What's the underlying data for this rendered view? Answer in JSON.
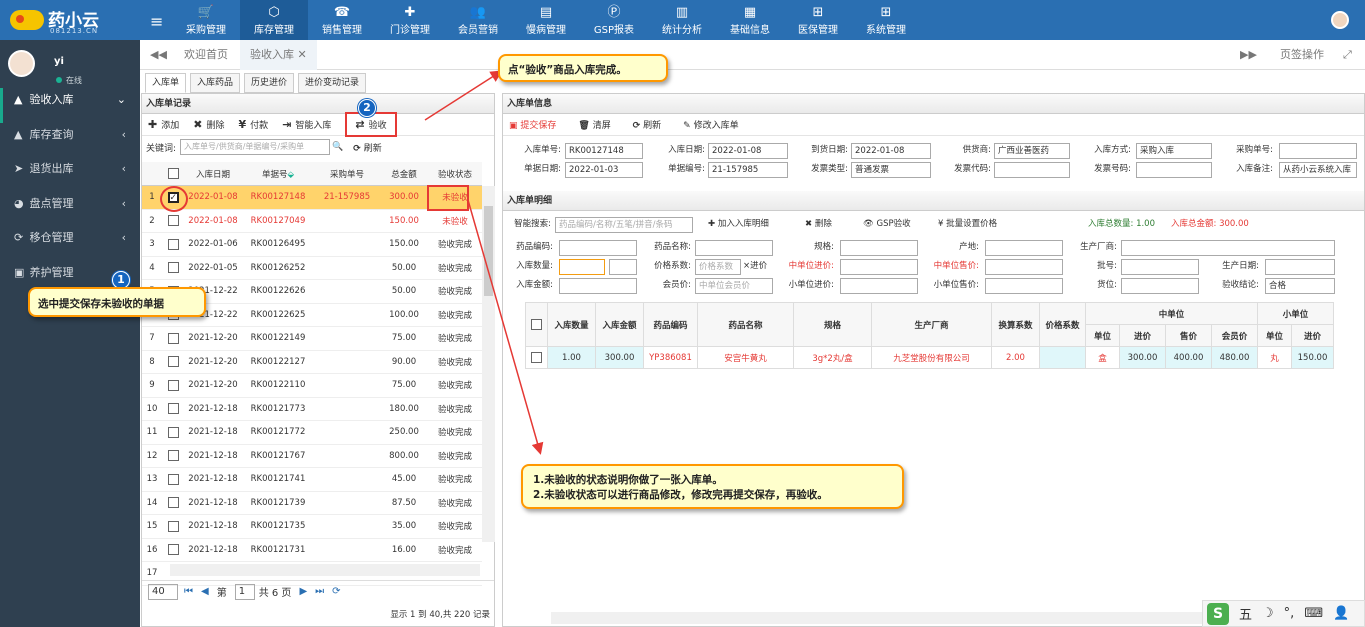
{
  "app": {
    "logo_text": "药小云",
    "logo_sub": "081213.CN"
  },
  "topmenu": [
    {
      "label": "采购管理",
      "icon": "🛒"
    },
    {
      "label": "库存管理",
      "icon": "⬡"
    },
    {
      "label": "销售管理",
      "icon": "☎"
    },
    {
      "label": "门诊管理",
      "icon": "✚"
    },
    {
      "label": "会员营销",
      "icon": "👥"
    },
    {
      "label": "慢病管理",
      "icon": "▤"
    },
    {
      "label": "GSP报表",
      "icon": "Ⓟ"
    },
    {
      "label": "统计分析",
      "icon": "▥"
    },
    {
      "label": "基础信息",
      "icon": "▦"
    },
    {
      "label": "医保管理",
      "icon": "⊞"
    },
    {
      "label": "系统管理",
      "icon": "⊞"
    }
  ],
  "sidebar": {
    "user": "yi",
    "status": "在线",
    "items": [
      {
        "label": "验收入库",
        "icon": "▲",
        "arrow": "⌄"
      },
      {
        "label": "库存查询",
        "icon": "▲",
        "arrow": "‹"
      },
      {
        "label": "退货出库",
        "icon": "➤",
        "arrow": "‹"
      },
      {
        "label": "盘点管理",
        "icon": "◕",
        "arrow": "‹"
      },
      {
        "label": "移仓管理",
        "icon": "⟳",
        "arrow": "‹"
      },
      {
        "label": "养护管理",
        "icon": "▣",
        "arrow": ""
      }
    ]
  },
  "tabs": {
    "home": "欢迎首页",
    "active": "验收入库",
    "close": "✕",
    "page_ops": "页签操作"
  },
  "subtabs": [
    "入库单",
    "入库药品",
    "历史进价",
    "进价变动记录"
  ],
  "left": {
    "title": "入库单记录",
    "toolbar": {
      "add": "添加",
      "delete": "删除",
      "pay": "付款",
      "smart": "智能入库",
      "verify": "验收"
    },
    "search": {
      "label": "关键词:",
      "placeholder": "入库单号/供货商/单据编号/采购单",
      "refresh": "刷新"
    },
    "columns": [
      "入库日期",
      "单据号",
      "采购单号",
      "总金额",
      "验收状态"
    ],
    "rows": [
      {
        "no": "1",
        "date": "2022-01-08",
        "id": "RK00127148",
        "po": "21-157985",
        "amt": "300.00",
        "status": "未验收",
        "checked": true
      },
      {
        "no": "2",
        "date": "2022-01-08",
        "id": "RK00127049",
        "po": "",
        "amt": "150.00",
        "status": "未验收",
        "checked": false
      },
      {
        "no": "3",
        "date": "2022-01-06",
        "id": "RK00126495",
        "po": "",
        "amt": "150.00",
        "status": "验收完成",
        "checked": false
      },
      {
        "no": "4",
        "date": "2022-01-05",
        "id": "RK00126252",
        "po": "",
        "amt": "50.00",
        "status": "验收完成",
        "checked": false
      },
      {
        "no": "5",
        "date": "2021-12-22",
        "id": "RK00122626",
        "po": "",
        "amt": "50.00",
        "status": "验收完成",
        "checked": false
      },
      {
        "no": "6",
        "date": "2021-12-22",
        "id": "RK00122625",
        "po": "",
        "amt": "100.00",
        "status": "验收完成",
        "checked": false
      },
      {
        "no": "7",
        "date": "2021-12-20",
        "id": "RK00122149",
        "po": "",
        "amt": "75.00",
        "status": "验收完成",
        "checked": false
      },
      {
        "no": "8",
        "date": "2021-12-20",
        "id": "RK00122127",
        "po": "",
        "amt": "90.00",
        "status": "验收完成",
        "checked": false
      },
      {
        "no": "9",
        "date": "2021-12-20",
        "id": "RK00122110",
        "po": "",
        "amt": "75.00",
        "status": "验收完成",
        "checked": false
      },
      {
        "no": "10",
        "date": "2021-12-18",
        "id": "RK00121773",
        "po": "",
        "amt": "180.00",
        "status": "验收完成",
        "checked": false
      },
      {
        "no": "11",
        "date": "2021-12-18",
        "id": "RK00121772",
        "po": "",
        "amt": "250.00",
        "status": "验收完成",
        "checked": false
      },
      {
        "no": "12",
        "date": "2021-12-18",
        "id": "RK00121767",
        "po": "",
        "amt": "800.00",
        "status": "验收完成",
        "checked": false
      },
      {
        "no": "13",
        "date": "2021-12-18",
        "id": "RK00121741",
        "po": "",
        "amt": "45.00",
        "status": "验收完成",
        "checked": false
      },
      {
        "no": "14",
        "date": "2021-12-18",
        "id": "RK00121739",
        "po": "",
        "amt": "87.50",
        "status": "验收完成",
        "checked": false
      },
      {
        "no": "15",
        "date": "2021-12-18",
        "id": "RK00121735",
        "po": "",
        "amt": "35.00",
        "status": "验收完成",
        "checked": false
      },
      {
        "no": "16",
        "date": "2021-12-18",
        "id": "RK00121731",
        "po": "",
        "amt": "16.00",
        "status": "验收完成",
        "checked": false
      },
      {
        "no": "17",
        "date": "",
        "id": "",
        "po": "",
        "amt": "",
        "status": "",
        "checked": false
      }
    ],
    "pager": {
      "size": "40",
      "page_label": "第",
      "page": "1",
      "total_pages": "共 6 页",
      "info": "显示 1 到 40,共 220 记录"
    }
  },
  "right": {
    "title": "入库单信息",
    "toolbar": {
      "submit": "提交保存",
      "clear": "清屏",
      "refresh": "刷新",
      "edit": "修改入库单"
    },
    "form": {
      "order_no_l": "入库单号:",
      "order_no": "RK00127148",
      "in_date_l": "入库日期:",
      "in_date": "2022-01-08",
      "arrive_l": "到货日期:",
      "arrive": "2022-01-08",
      "supplier_l": "供货商:",
      "supplier": "广西业善医药",
      "method_l": "入库方式:",
      "method": "采购入库",
      "po_l": "采购单号:",
      "po": "",
      "doc_date_l": "单据日期:",
      "doc_date": "2022-01-03",
      "doc_no_l": "单据编号:",
      "doc_no": "21-157985",
      "inv_type_l": "发票类型:",
      "inv_type": "普通发票",
      "inv_code_l": "发票代码:",
      "inv_code": "",
      "inv_no_l": "发票号码:",
      "inv_no": "",
      "remark_l": "入库备注:",
      "remark": "从药小云系统入库"
    },
    "detail_title": "入库单明细",
    "detail_toolbar": {
      "search_l": "智能搜索:",
      "search_ph": "药品编码/名称/五笔/拼音/条码",
      "add": "加入入库明细",
      "del": "删除",
      "gsp": "GSP验收",
      "batch": "批量设置价格",
      "total_qty": "入库总数量: 1.00",
      "total_amt": "入库总金额: 300.00"
    },
    "dform": {
      "code_l": "药品编码:",
      "name_l": "药品名称:",
      "spec_l": "规格:",
      "origin_l": "产地:",
      "maker_l": "生产厂商:",
      "qty_l": "入库数量:",
      "factor_l": "价格系数:",
      "factor_ph": "价格系数",
      "factor_x": "×进价",
      "mid_price_l": "中单位进价:",
      "mid_sale_l": "中单位售价:",
      "batch_l": "批号:",
      "prod_date_l": "生产日期:",
      "amt_l": "入库金额:",
      "member_l": "会员价:",
      "member_ph": "中单位会员价",
      "small_price_l": "小单位进价:",
      "small_sale_l": "小单位售价:",
      "loc_l": "货位:",
      "result_l": "验收结论:",
      "result": "合格"
    },
    "dcols": [
      "入库数量",
      "入库金额",
      "药品编码",
      "药品名称",
      "规格",
      "生产厂商",
      "换算系数",
      "价格系数",
      "中单位",
      "小单位",
      "单位",
      "进价",
      "售价",
      "会员价",
      "单位",
      "进价"
    ],
    "drow": {
      "qty": "1.00",
      "amt": "300.00",
      "code": "YP386081",
      "name": "安宫牛黄丸",
      "spec": "3g*2丸/盒",
      "maker": "九芝堂股份有限公司",
      "conv": "2.00",
      "factor": "",
      "mid_unit": "盒",
      "mid_price": "300.00",
      "mid_sale": "400.00",
      "mid_member": "480.00",
      "small_unit": "丸",
      "small_price": "150.00"
    }
  },
  "callouts": {
    "c1": "选中提交保存未验收的单据",
    "c2": "点“验收”商品入库完成。",
    "c3a": "1.未验收的状态说明你做了一张入库单。",
    "c3b": "2.未验收状态可以进行商品修改，修改完再提交保存，再验收。",
    "n1": "1",
    "n2": "2"
  },
  "ime": {
    "s": "S",
    "w": "五",
    "m": "☽",
    "p": "°,"
  }
}
